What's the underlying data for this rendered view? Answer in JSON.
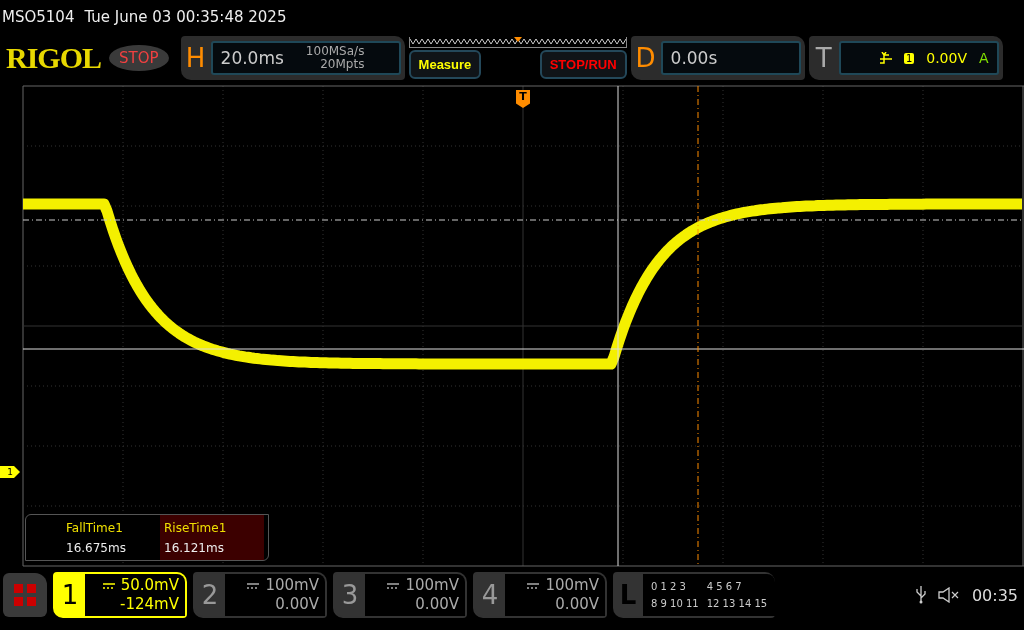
{
  "header": {
    "model": "MSO5104",
    "datetime": "Tue June 03 00:35:48 2025"
  },
  "toolbar": {
    "logo": "RIGOL",
    "run_state": "STOP",
    "horizontal": {
      "label": "H",
      "timebase": "20.0ms",
      "sample_rate": "100MSa/s",
      "memory_depth": "20Mpts"
    },
    "buttons": [
      {
        "label": "Measure",
        "color": "#ffff00"
      },
      {
        "label": "STOP/RUN",
        "color": "#ff0000"
      }
    ],
    "delay": {
      "label": "D",
      "value": "0.00s"
    },
    "trigger": {
      "label": "T",
      "source": "1",
      "level": "0.00V",
      "mode": "A"
    }
  },
  "plot": {
    "trigger_marker": "T",
    "channel_marker": "1"
  },
  "measurements": [
    {
      "label": "FallTime1",
      "value": "16.675ms",
      "selected": false
    },
    {
      "label": "RiseTime1",
      "value": "16.121ms",
      "selected": true
    }
  ],
  "channels": [
    {
      "number": "1",
      "scale": "50.0mV",
      "offset": "-124mV",
      "selected": true
    },
    {
      "number": "2",
      "scale": "100mV",
      "offset": "0.00V",
      "selected": false
    },
    {
      "number": "3",
      "scale": "100mV",
      "offset": "0.00V",
      "selected": false
    },
    {
      "number": "4",
      "scale": "100mV",
      "offset": "0.00V",
      "selected": false
    }
  ],
  "logic": {
    "label": "L",
    "groups": [
      "0 1 2 3",
      "4 5 6 7",
      "8 9 10 11",
      "12 13 14 15"
    ]
  },
  "status": {
    "time": "00:35"
  }
}
